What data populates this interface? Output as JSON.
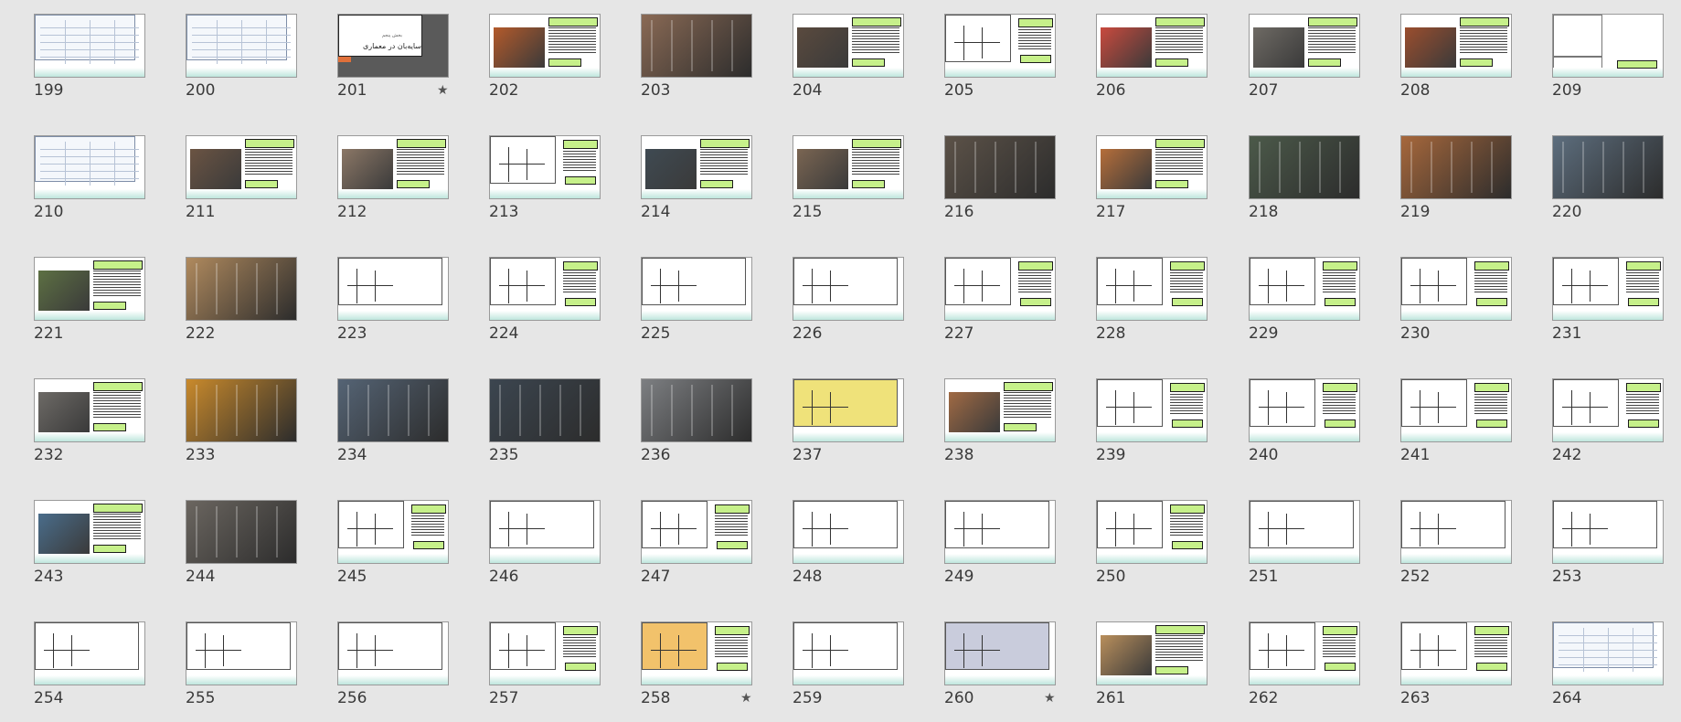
{
  "slides": [
    {
      "number": "199",
      "starred": false,
      "style": "table"
    },
    {
      "number": "200",
      "starred": false,
      "style": "table"
    },
    {
      "number": "201",
      "starred": true,
      "style": "title",
      "title": "سایه‌بان در معماری",
      "subtitle": "بخش پنجم"
    },
    {
      "number": "202",
      "starred": false,
      "style": "photo-text",
      "photo": "#b35a2b"
    },
    {
      "number": "203",
      "starred": false,
      "style": "photo",
      "photo": "#8a6a55"
    },
    {
      "number": "204",
      "starred": false,
      "style": "photo-text",
      "photo": "#5a4a3e"
    },
    {
      "number": "205",
      "starred": false,
      "style": "diagram-text"
    },
    {
      "number": "206",
      "starred": false,
      "style": "photo-text",
      "photo": "#c94a3e"
    },
    {
      "number": "207",
      "starred": false,
      "style": "photo-text",
      "photo": "#6e6a64"
    },
    {
      "number": "208",
      "starred": false,
      "style": "photo-text",
      "photo": "#9b4e2e"
    },
    {
      "number": "209",
      "starred": false,
      "style": "chart"
    },
    {
      "number": "210",
      "starred": false,
      "style": "table"
    },
    {
      "number": "211",
      "starred": false,
      "style": "photo-text",
      "photo": "#6b5443"
    },
    {
      "number": "212",
      "starred": false,
      "style": "photo-text",
      "photo": "#8b7766"
    },
    {
      "number": "213",
      "starred": false,
      "style": "diagram-text"
    },
    {
      "number": "214",
      "starred": false,
      "style": "photo-text",
      "photo": "#3f4a52"
    },
    {
      "number": "215",
      "starred": false,
      "style": "photo-text",
      "photo": "#7a6552"
    },
    {
      "number": "216",
      "starred": false,
      "style": "photo",
      "photo": "#5c5248"
    },
    {
      "number": "217",
      "starred": false,
      "style": "photo-text",
      "photo": "#b56e3a"
    },
    {
      "number": "218",
      "starred": false,
      "style": "photo",
      "photo": "#4c5a4a"
    },
    {
      "number": "219",
      "starred": false,
      "style": "photo",
      "photo": "#a7683c"
    },
    {
      "number": "220",
      "starred": false,
      "style": "photo",
      "photo": "#5d6e7e"
    },
    {
      "number": "221",
      "starred": false,
      "style": "photo-text",
      "photo": "#5d7043"
    },
    {
      "number": "222",
      "starred": false,
      "style": "photo",
      "photo": "#b08a5e"
    },
    {
      "number": "223",
      "starred": false,
      "style": "diagram"
    },
    {
      "number": "224",
      "starred": false,
      "style": "diagram-text"
    },
    {
      "number": "225",
      "starred": false,
      "style": "diagram"
    },
    {
      "number": "226",
      "starred": false,
      "style": "diagram"
    },
    {
      "number": "227",
      "starred": false,
      "style": "diagram-text"
    },
    {
      "number": "228",
      "starred": false,
      "style": "diagram-text"
    },
    {
      "number": "229",
      "starred": false,
      "style": "diagram-text"
    },
    {
      "number": "230",
      "starred": false,
      "style": "diagram-text"
    },
    {
      "number": "231",
      "starred": false,
      "style": "diagram-text"
    },
    {
      "number": "232",
      "starred": false,
      "style": "photo-text",
      "photo": "#6d6a66"
    },
    {
      "number": "233",
      "starred": false,
      "style": "photo",
      "photo": "#c98a2c"
    },
    {
      "number": "234",
      "starred": false,
      "style": "photo",
      "photo": "#556475"
    },
    {
      "number": "235",
      "starred": false,
      "style": "photo",
      "photo": "#3c4650"
    },
    {
      "number": "236",
      "starred": false,
      "style": "photo",
      "photo": "#7d7f82"
    },
    {
      "number": "237",
      "starred": false,
      "style": "diagram",
      "photo": "#efe27a"
    },
    {
      "number": "238",
      "starred": false,
      "style": "photo-text",
      "photo": "#a06a44"
    },
    {
      "number": "239",
      "starred": false,
      "style": "diagram-text"
    },
    {
      "number": "240",
      "starred": false,
      "style": "diagram-text"
    },
    {
      "number": "241",
      "starred": false,
      "style": "diagram-text"
    },
    {
      "number": "242",
      "starred": false,
      "style": "diagram-text"
    },
    {
      "number": "243",
      "starred": false,
      "style": "photo-text",
      "photo": "#4a6d8b"
    },
    {
      "number": "244",
      "starred": false,
      "style": "photo",
      "photo": "#6b6660"
    },
    {
      "number": "245",
      "starred": false,
      "style": "diagram-text"
    },
    {
      "number": "246",
      "starred": false,
      "style": "diagram"
    },
    {
      "number": "247",
      "starred": false,
      "style": "diagram-text"
    },
    {
      "number": "248",
      "starred": false,
      "style": "diagram"
    },
    {
      "number": "249",
      "starred": false,
      "style": "diagram"
    },
    {
      "number": "250",
      "starred": false,
      "style": "diagram-text"
    },
    {
      "number": "251",
      "starred": false,
      "style": "diagram"
    },
    {
      "number": "252",
      "starred": false,
      "style": "diagram"
    },
    {
      "number": "253",
      "starred": false,
      "style": "diagram"
    },
    {
      "number": "254",
      "starred": false,
      "style": "diagram"
    },
    {
      "number": "255",
      "starred": false,
      "style": "diagram"
    },
    {
      "number": "256",
      "starred": false,
      "style": "diagram"
    },
    {
      "number": "257",
      "starred": false,
      "style": "diagram-text"
    },
    {
      "number": "258",
      "starred": true,
      "style": "diagram-text",
      "photo": "#f2c26b"
    },
    {
      "number": "259",
      "starred": false,
      "style": "diagram"
    },
    {
      "number": "260",
      "starred": true,
      "style": "diagram",
      "photo": "#c9ccdc"
    },
    {
      "number": "261",
      "starred": false,
      "style": "photo-text",
      "photo": "#b98f5c"
    },
    {
      "number": "262",
      "starred": false,
      "style": "diagram-text"
    },
    {
      "number": "263",
      "starred": false,
      "style": "diagram-text"
    },
    {
      "number": "264",
      "starred": false,
      "style": "table"
    }
  ],
  "icons": {
    "star": "star-icon"
  },
  "colors": {
    "background": "#e6e6e6",
    "label": "#3a3a3a",
    "textbox": "#c6f08a"
  }
}
